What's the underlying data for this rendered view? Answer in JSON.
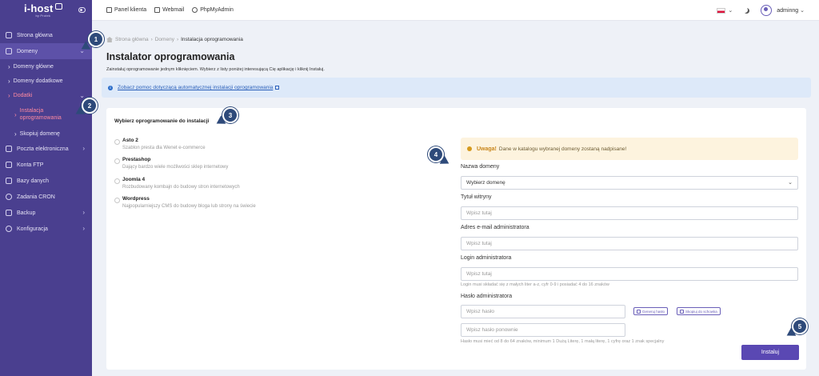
{
  "brand": {
    "name": "i-host",
    "tagline": "by Protek"
  },
  "topbar": {
    "links": [
      {
        "label": "Panel klienta",
        "icon": "home-icon"
      },
      {
        "label": "Webmail",
        "icon": "mail-icon"
      },
      {
        "label": "PhpMyAdmin",
        "icon": "settings-icon"
      }
    ],
    "language_flag": "pl",
    "user": "adminng"
  },
  "sidebar": {
    "items": [
      {
        "label": "Strona główna",
        "icon": "home-icon"
      },
      {
        "label": "Domeny",
        "icon": "chart-icon",
        "expanded": true
      },
      {
        "label": "Domeny główne"
      },
      {
        "label": "Domeny dodatkowe"
      },
      {
        "label": "Dodatki"
      },
      {
        "label": "Instalacja oprogramowania"
      },
      {
        "label": "Skopiuj domenę"
      },
      {
        "label": "Poczta elektroniczna",
        "icon": "mail-icon"
      },
      {
        "label": "Konta FTP",
        "icon": "folder-icon"
      },
      {
        "label": "Bazy danych",
        "icon": "database-icon"
      },
      {
        "label": "Zadania CRON",
        "icon": "clock-icon"
      },
      {
        "label": "Backup",
        "icon": "backup-icon"
      },
      {
        "label": "Konfiguracja",
        "icon": "gear-icon"
      }
    ]
  },
  "breadcrumb": [
    "Strona główna",
    "Domeny",
    "Instalacja oprogramowania"
  ],
  "page": {
    "title": "Instalator oprogramowania",
    "description": "Zainstaluj oprogramowanie jednym kliknięciem. Wybierz z listy poniżej interesującą Cię aplikację i kliknij Instaluj."
  },
  "info": {
    "link_text": "Zobacz pomoc dotyczącą automatycznej instalacji oprogramowania"
  },
  "installer": {
    "panel_title": "Wybierz oprogramowanie do instalacji",
    "apps": [
      {
        "name": "Asto 2",
        "desc": "Szablon presta dla Wenet e-commerce"
      },
      {
        "name": "Prestashop",
        "desc": "Dający bardzo wiele możliwości sklep internetowy"
      },
      {
        "name": "Joomla 4",
        "desc": "Rozbudowany kombajn do budowy stron internetowych"
      },
      {
        "name": "Wordpress",
        "desc": "Najpopularniejszy CMS do budowy bloga lub strony na świecie"
      }
    ],
    "warning_strong": "Uwaga!",
    "warning_text": "Dane w katalogu wybranej domeny zostaną nadpisane!",
    "domain_label": "Nazwa domeny",
    "domain_value": "Wybierz domenę",
    "site_title_label": "Tytuł witryny",
    "site_title_placeholder": "Wpisz tutaj",
    "email_label": "Adres e-mail administratora",
    "email_placeholder": "Wpisz tutaj",
    "login_label": "Login administratora",
    "login_placeholder": "Wpisz tutaj",
    "login_hint": "Login musi składać się z małych liter a-z, cyfr 0-9 i posiadać 4 do 16 znaków",
    "password_label": "Hasło administratora",
    "password_placeholder": "Wpisz hasło",
    "generate_label": "Generuj hasło",
    "copy_label": "Skopiuj do schowka",
    "password_repeat_placeholder": "Wpisz hasło ponownie",
    "password_hint": "Hasło musi mieć od 8 do 64 znaków, minimum 1 Dużą Literę, 1 małą literę, 1 cyfrę oraz 1 znak specjalny",
    "install_label": "Instaluj"
  },
  "markers": [
    "1",
    "2",
    "3",
    "4",
    "5"
  ]
}
